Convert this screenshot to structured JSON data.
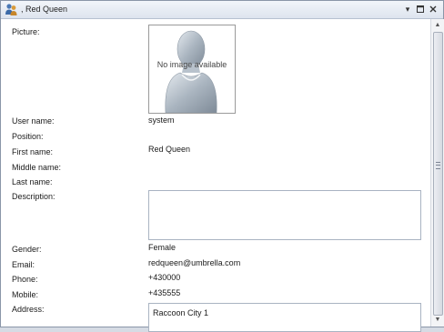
{
  "window": {
    "title": ", Red Queen",
    "icons": {
      "app": "user-group-icon",
      "pin": "pin-icon",
      "maximize": "maximize-icon",
      "close": "close-icon"
    }
  },
  "picture": {
    "label": "Picture:",
    "placeholder_text": "No image available",
    "icon": "user-silhouette-icon"
  },
  "fields": {
    "user_name": {
      "label": "User name:",
      "value": "system"
    },
    "position": {
      "label": "Position:",
      "value": ""
    },
    "first_name": {
      "label": "First name:",
      "value": "Red Queen"
    },
    "middle_name": {
      "label": "Middle name:",
      "value": ""
    },
    "last_name": {
      "label": "Last name:",
      "value": ""
    },
    "description": {
      "label": "Description:",
      "value": ""
    },
    "gender": {
      "label": "Gender:",
      "value": "Female"
    },
    "email": {
      "label": "Email:",
      "value": "redqueen@umbrella.com"
    },
    "phone": {
      "label": "Phone:",
      "value": "+430000"
    },
    "mobile": {
      "label": "Mobile:",
      "value": "+435555"
    },
    "address": {
      "label": "Address:",
      "value": "Raccoon City 1"
    }
  },
  "colors": {
    "accent_border": "#a9b3c2",
    "title_gradient_top": "#f2f5fa"
  }
}
